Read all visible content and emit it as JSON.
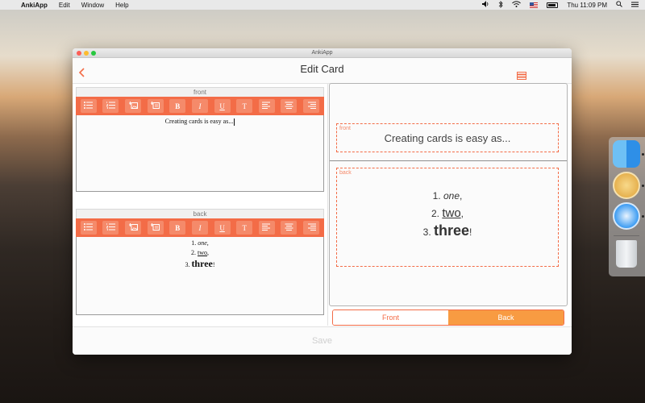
{
  "menubar": {
    "app_name": "AnkiApp",
    "menus": [
      "Edit",
      "Window",
      "Help"
    ],
    "clock": "Thu 11:09 PM",
    "apple_glyph": "",
    "icons": [
      "apple-icon",
      "volume-icon",
      "bluetooth-icon",
      "wifi-icon",
      "flag-icon",
      "battery-icon",
      "search-icon",
      "menu-icon"
    ]
  },
  "window": {
    "title": "AnkiApp",
    "header_title": "Edit Card"
  },
  "editor": {
    "front_label": "front",
    "back_label": "back",
    "toolbar_buttons": [
      {
        "name": "bullet-list-icon",
        "glyph": ""
      },
      {
        "name": "numbered-list-icon",
        "glyph": ""
      },
      {
        "name": "insert-image-icon",
        "glyph": ""
      },
      {
        "name": "insert-audio-icon",
        "glyph": ""
      },
      {
        "name": "bold-icon",
        "glyph": "B"
      },
      {
        "name": "italic-icon",
        "glyph": "I"
      },
      {
        "name": "underline-icon",
        "glyph": "U"
      },
      {
        "name": "clear-format-icon",
        "glyph": "T"
      },
      {
        "name": "align-left-icon",
        "glyph": ""
      },
      {
        "name": "align-center-icon",
        "glyph": ""
      },
      {
        "name": "align-right-icon",
        "glyph": ""
      }
    ],
    "front_text": "Creating cards is easy as...",
    "back_lines": [
      {
        "num": "1.",
        "text": "one",
        "suffix": ","
      },
      {
        "num": "2.",
        "text": "two",
        "suffix": ","
      },
      {
        "num": "3.",
        "text": "three",
        "suffix": "!"
      }
    ]
  },
  "preview": {
    "front_label": "front",
    "back_label": "back",
    "front_text": "Creating cards is easy as...",
    "back_lines": [
      {
        "num": "1.",
        "text": "one",
        "suffix": ","
      },
      {
        "num": "2.",
        "text": "two",
        "suffix": ","
      },
      {
        "num": "3.",
        "text": "three",
        "suffix": "!"
      }
    ]
  },
  "toggle": {
    "front": "Front",
    "back": "Back",
    "selected": "Back"
  },
  "footer": {
    "save_label": "Save"
  },
  "colors": {
    "accent": "#f36c47",
    "toggle_active": "#f89b42"
  }
}
